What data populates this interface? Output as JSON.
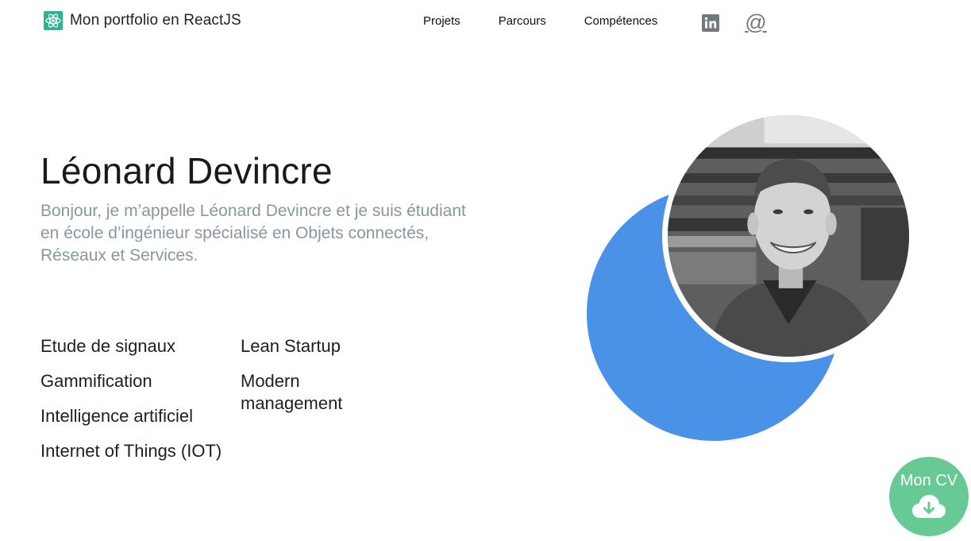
{
  "header": {
    "brand_title": "Mon portfolio en ReactJS",
    "nav": [
      {
        "label": "Projets"
      },
      {
        "label": "Parcours"
      },
      {
        "label": "Compétences"
      }
    ],
    "social": {
      "linkedin_icon": "linkedin-icon",
      "email_icon": "at-sign-icon",
      "email_glyph": "@"
    }
  },
  "hero": {
    "name": "Léonard Devincre",
    "intro": "Bonjour, je m’appelle Léonard Devincre et je suis étudiant en école d’ingénieur spécialisé en Objets connectés, Réseaux et Services.",
    "skills_col1": [
      "Etude de signaux",
      "Gammification",
      "Intelligence artificiel",
      "Internet of Things (IOT)"
    ],
    "skills_col2": [
      "Lean Startup",
      "Modern management"
    ]
  },
  "cv_button": {
    "label": "Mon CV",
    "icon": "cloud-download-icon"
  },
  "colors": {
    "accent_blue": "#4a92e8",
    "cv_green": "#67c994",
    "intro_gray": "#8797a2",
    "brand_teal": "#2bb58f"
  }
}
